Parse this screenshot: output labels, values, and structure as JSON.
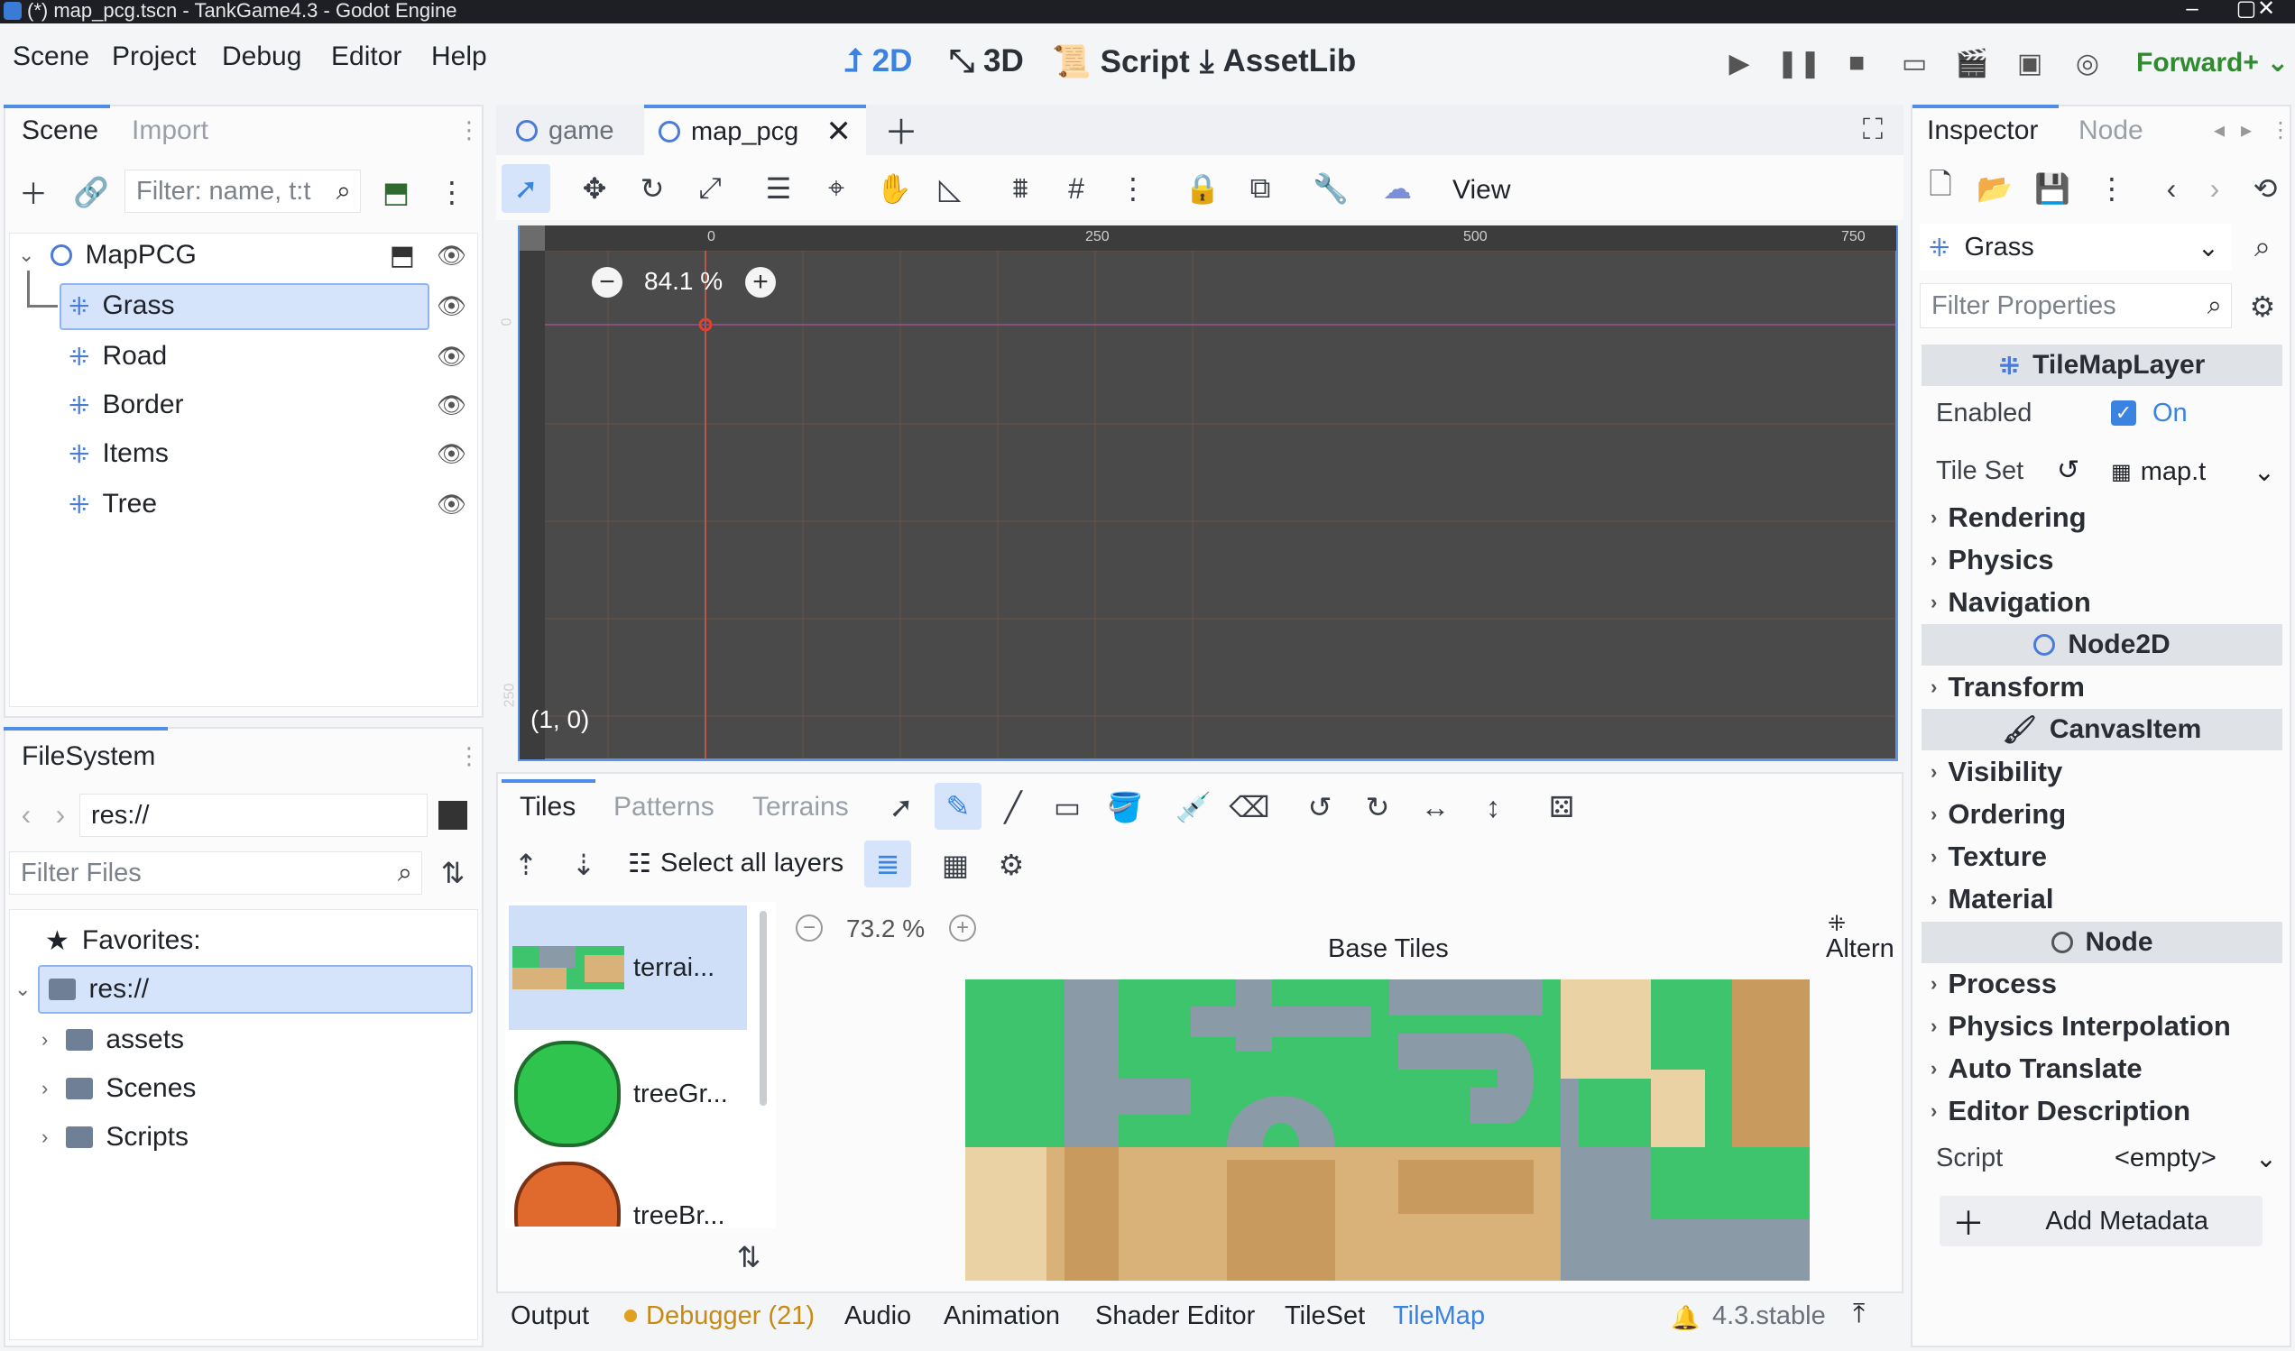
{
  "window": {
    "title": "(*) map_pcg.tscn - TankGame4.3 - Godot Engine",
    "controls": [
      "–",
      "▢",
      "✕"
    ]
  },
  "menu": [
    "Scene",
    "Project",
    "Debug",
    "Editor",
    "Help"
  ],
  "main_tabs": [
    {
      "label": "2D",
      "icon": "2d-icon"
    },
    {
      "label": "3D",
      "icon": "3d-icon"
    },
    {
      "label": "Script",
      "icon": "script-icon"
    },
    {
      "label": "AssetLib",
      "icon": "assetlib-icon"
    }
  ],
  "renderer": "Forward+",
  "scene_dock": {
    "tabs": [
      "Scene",
      "Import"
    ],
    "filter_placeholder": "Filter: name, t:t",
    "root": "MapPCG",
    "children": [
      "Grass",
      "Road",
      "Border",
      "Items",
      "Tree"
    ],
    "selected": "Grass"
  },
  "filesystem": {
    "tab": "FileSystem",
    "path": "res://",
    "filter_placeholder": "Filter Files",
    "favorites": "Favorites:",
    "root": "res://",
    "folders": [
      "assets",
      "Scenes",
      "Scripts"
    ]
  },
  "editor_tabs": [
    "game",
    "map_pcg"
  ],
  "viewport": {
    "zoom": "84.1 %",
    "view_label": "View",
    "coords": "(1, 0)",
    "ruler_h": [
      "0",
      "250",
      "500",
      "750"
    ],
    "ruler_v": [
      "0",
      "250"
    ]
  },
  "tilemap_panel": {
    "tabs": [
      "Tiles",
      "Patterns",
      "Terrains"
    ],
    "select_all_layers": "Select all layers",
    "sources": [
      "terrai...",
      "treeGr...",
      "treeBr..."
    ],
    "zoom": "73.2 %",
    "atlas_title": "Base Tiles",
    "alternative": "Altern"
  },
  "bottom_tabs": [
    "Output",
    "Debugger (21)",
    "Audio",
    "Animation",
    "Shader Editor",
    "TileSet",
    "TileMap"
  ],
  "version": "4.3.stable",
  "inspector": {
    "tabs": [
      "Inspector",
      "Node"
    ],
    "object": "Grass",
    "filter_placeholder": "Filter Properties",
    "class_tilemaplayer": "TileMapLayer",
    "enabled_label": "Enabled",
    "enabled_value": "On",
    "tileset_label": "Tile Set",
    "tileset_value": "map.t",
    "tilemap_sections": [
      "Rendering",
      "Physics",
      "Navigation"
    ],
    "class_node2d": "Node2D",
    "node2d_sections": [
      "Transform"
    ],
    "class_canvasitem": "CanvasItem",
    "canvas_sections": [
      "Visibility",
      "Ordering",
      "Texture",
      "Material"
    ],
    "class_node": "Node",
    "node_sections": [
      "Process",
      "Physics Interpolation",
      "Auto Translate",
      "Editor Description"
    ],
    "script_label": "Script",
    "script_value": "<empty>",
    "add_metadata": "Add Metadata"
  },
  "colors": {
    "accent": "#3a83e0",
    "warning": "#e0a020",
    "viewport_bg": "#4a4a4a",
    "grass": "#3ec46d",
    "road": "#8a9aa6",
    "sand": "#d9b27a"
  }
}
